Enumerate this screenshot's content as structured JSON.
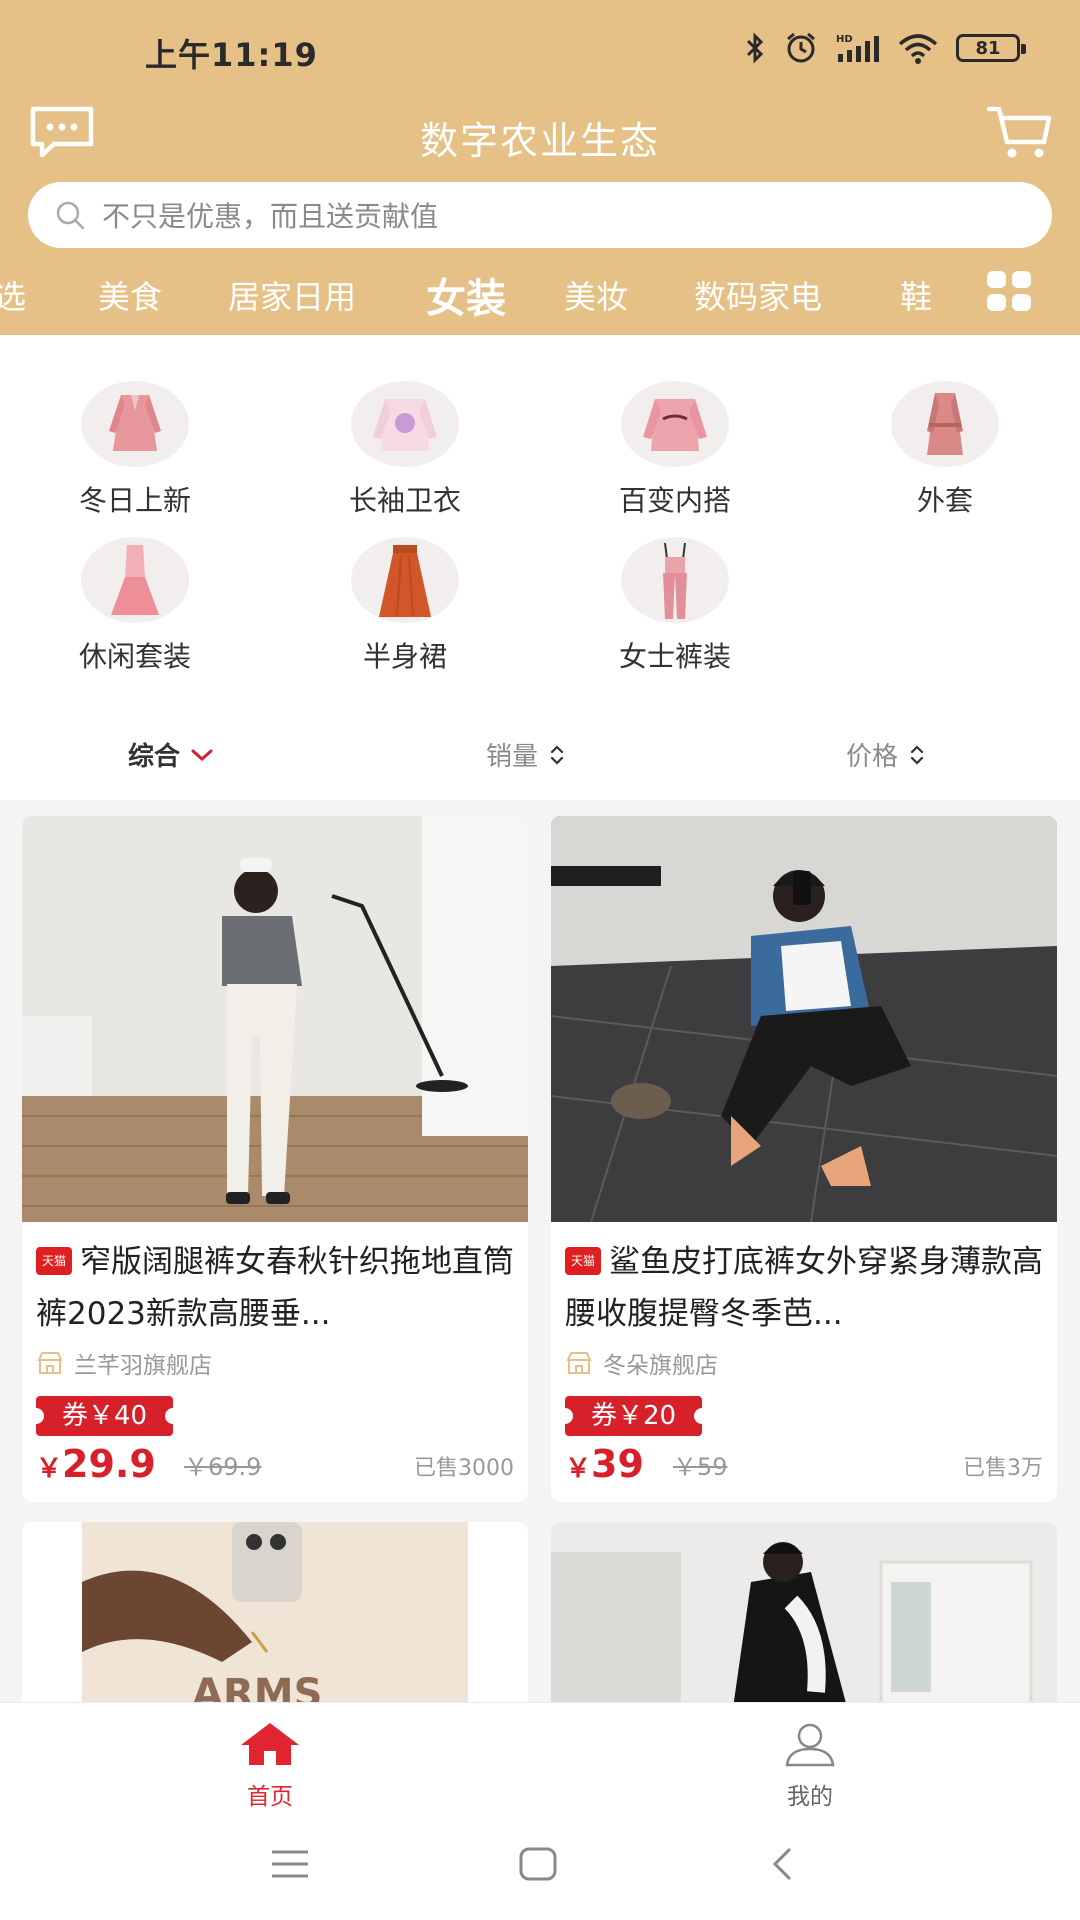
{
  "status_bar": {
    "time": "上午11:19",
    "battery": "81"
  },
  "header": {
    "title": "数字农业生态",
    "search_placeholder": "不只是优惠，而且送贡献值"
  },
  "categories": [
    "精选",
    "美食",
    "居家日用",
    "女装",
    "美妆",
    "数码家电",
    "鞋"
  ],
  "categories_display": [
    "选",
    "美食",
    "居家日用",
    "女装",
    "美妆",
    "数码家电",
    "鞋"
  ],
  "active_category": "女装",
  "subcategories": [
    {
      "label": "冬日上新"
    },
    {
      "label": "长袖卫衣"
    },
    {
      "label": "百变内搭"
    },
    {
      "label": "外套"
    },
    {
      "label": "休闲套装"
    },
    {
      "label": "半身裙"
    },
    {
      "label": "女士裤装"
    }
  ],
  "sort": {
    "comprehensive": "综合",
    "sales": "销量",
    "price": "价格"
  },
  "products": [
    {
      "title": "窄版阔腿裤女春秋针织拖地直筒裤2023新款高腰垂...",
      "badge": "天猫",
      "store": "兰芊羽旗舰店",
      "coupon": "券￥40",
      "currency": "￥",
      "price": "29.9",
      "original": "￥69.9",
      "sold": "已售3000"
    },
    {
      "title": "鲨鱼皮打底裤女外穿紧身薄款高腰收腹提臀冬季芭...",
      "badge": "天猫",
      "store": "冬朵旗舰店",
      "coupon": "券￥20",
      "currency": "￥",
      "price": "39",
      "original": "￥59",
      "sold": "已售3万"
    },
    {
      "print_text": "ARMS"
    },
    {}
  ],
  "bottom_nav": {
    "home": "首页",
    "mine": "我的"
  },
  "colors": {
    "header": "#e6c187",
    "accent_red": "#d7202a"
  }
}
